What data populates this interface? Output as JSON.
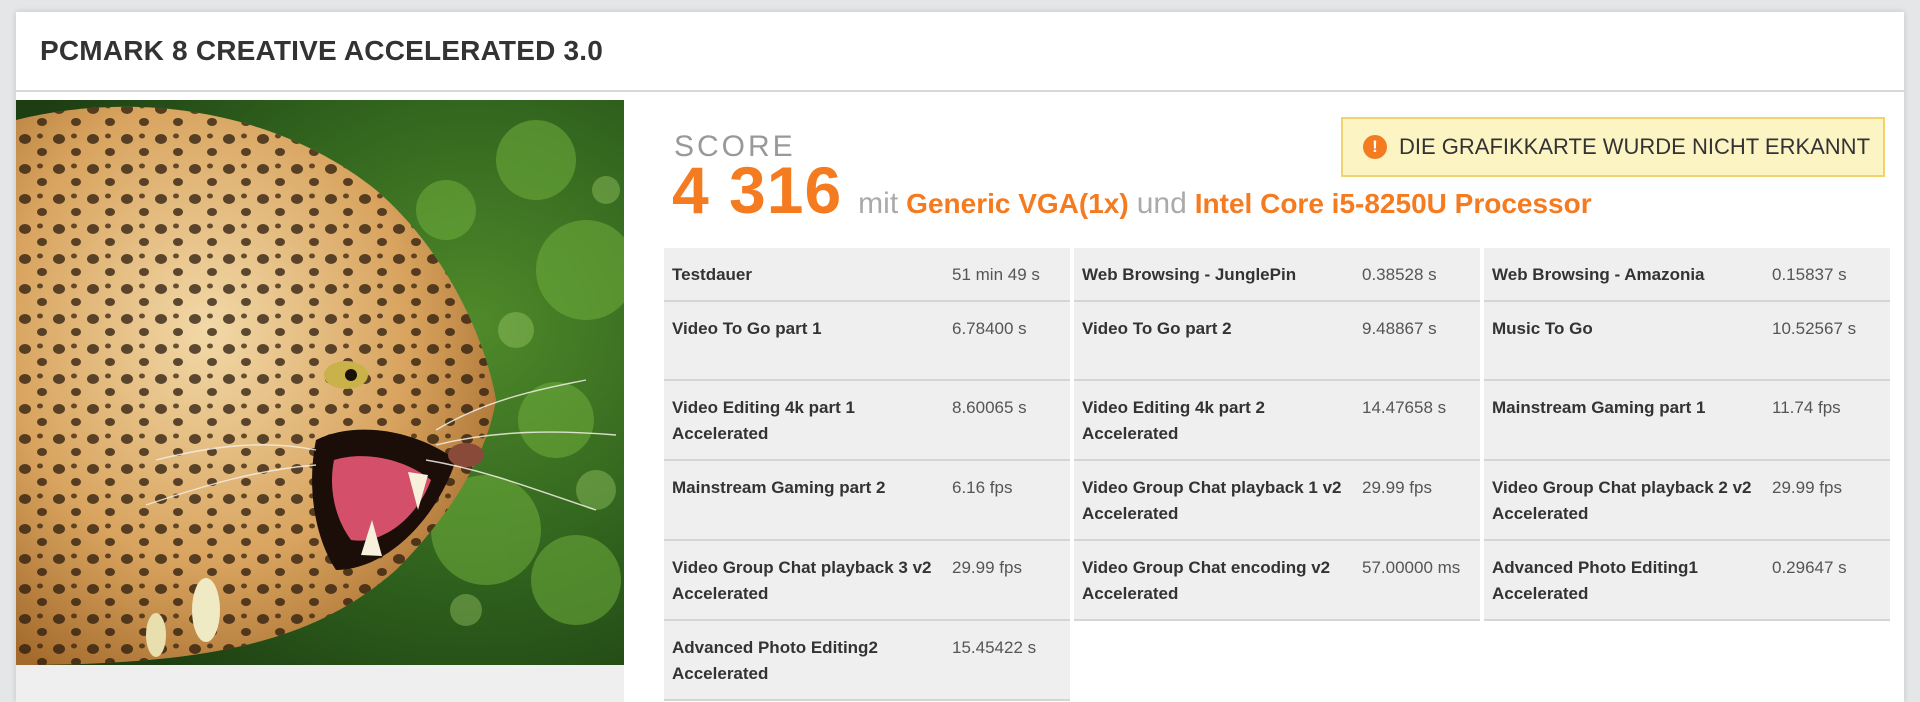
{
  "header": {
    "title": "PCMARK 8 CREATIVE ACCELERATED 3.0"
  },
  "image": {
    "subject": "leopard-photo"
  },
  "score": {
    "label": "SCORE",
    "value": "4 316",
    "mit": "mit",
    "gpu": "Generic VGA(1x)",
    "und": "und",
    "cpu": "Intel Core i5-8250U Processor"
  },
  "warning": {
    "text": "DIE GRAFIKKARTE WURDE NICHT ERKANNT",
    "icon": "exclamation-icon"
  },
  "colors": {
    "accent": "#f47b20",
    "warning_bg": "#fdf4c4",
    "warning_border": "#f2d36b"
  },
  "results": [
    [
      {
        "name": "Testdauer",
        "value": "51 min 49 s"
      },
      {
        "name": "Web Browsing - JunglePin",
        "value": "0.38528 s"
      },
      {
        "name": "Web Browsing - Amazonia",
        "value": "0.15837 s"
      }
    ],
    [
      {
        "name": "Video To Go part 1",
        "value": "6.78400 s"
      },
      {
        "name": "Video To Go part 2",
        "value": "9.48867 s"
      },
      {
        "name": "Music To Go",
        "value": "10.52567 s"
      }
    ],
    [
      {
        "name": "Video Editing 4k part 1 Accelerated",
        "value": "8.60065 s"
      },
      {
        "name": "Video Editing 4k part 2 Accelerated",
        "value": "14.47658 s"
      },
      {
        "name": "Mainstream Gaming part 1",
        "value": "11.74 fps"
      }
    ],
    [
      {
        "name": "Mainstream Gaming part 2",
        "value": "6.16 fps"
      },
      {
        "name": "Video Group Chat playback 1 v2 Accelerated",
        "value": "29.99 fps"
      },
      {
        "name": "Video Group Chat playback 2 v2 Accelerated",
        "value": "29.99 fps"
      }
    ],
    [
      {
        "name": "Video Group Chat playback 3 v2 Accelerated",
        "value": "29.99 fps"
      },
      {
        "name": "Video Group Chat encoding v2 Accelerated",
        "value": "57.00000 ms"
      },
      {
        "name": "Advanced Photo Editing1 Accelerated",
        "value": "0.29647 s"
      }
    ],
    [
      {
        "name": "Advanced Photo Editing2 Accelerated",
        "value": "15.45422 s"
      }
    ]
  ]
}
